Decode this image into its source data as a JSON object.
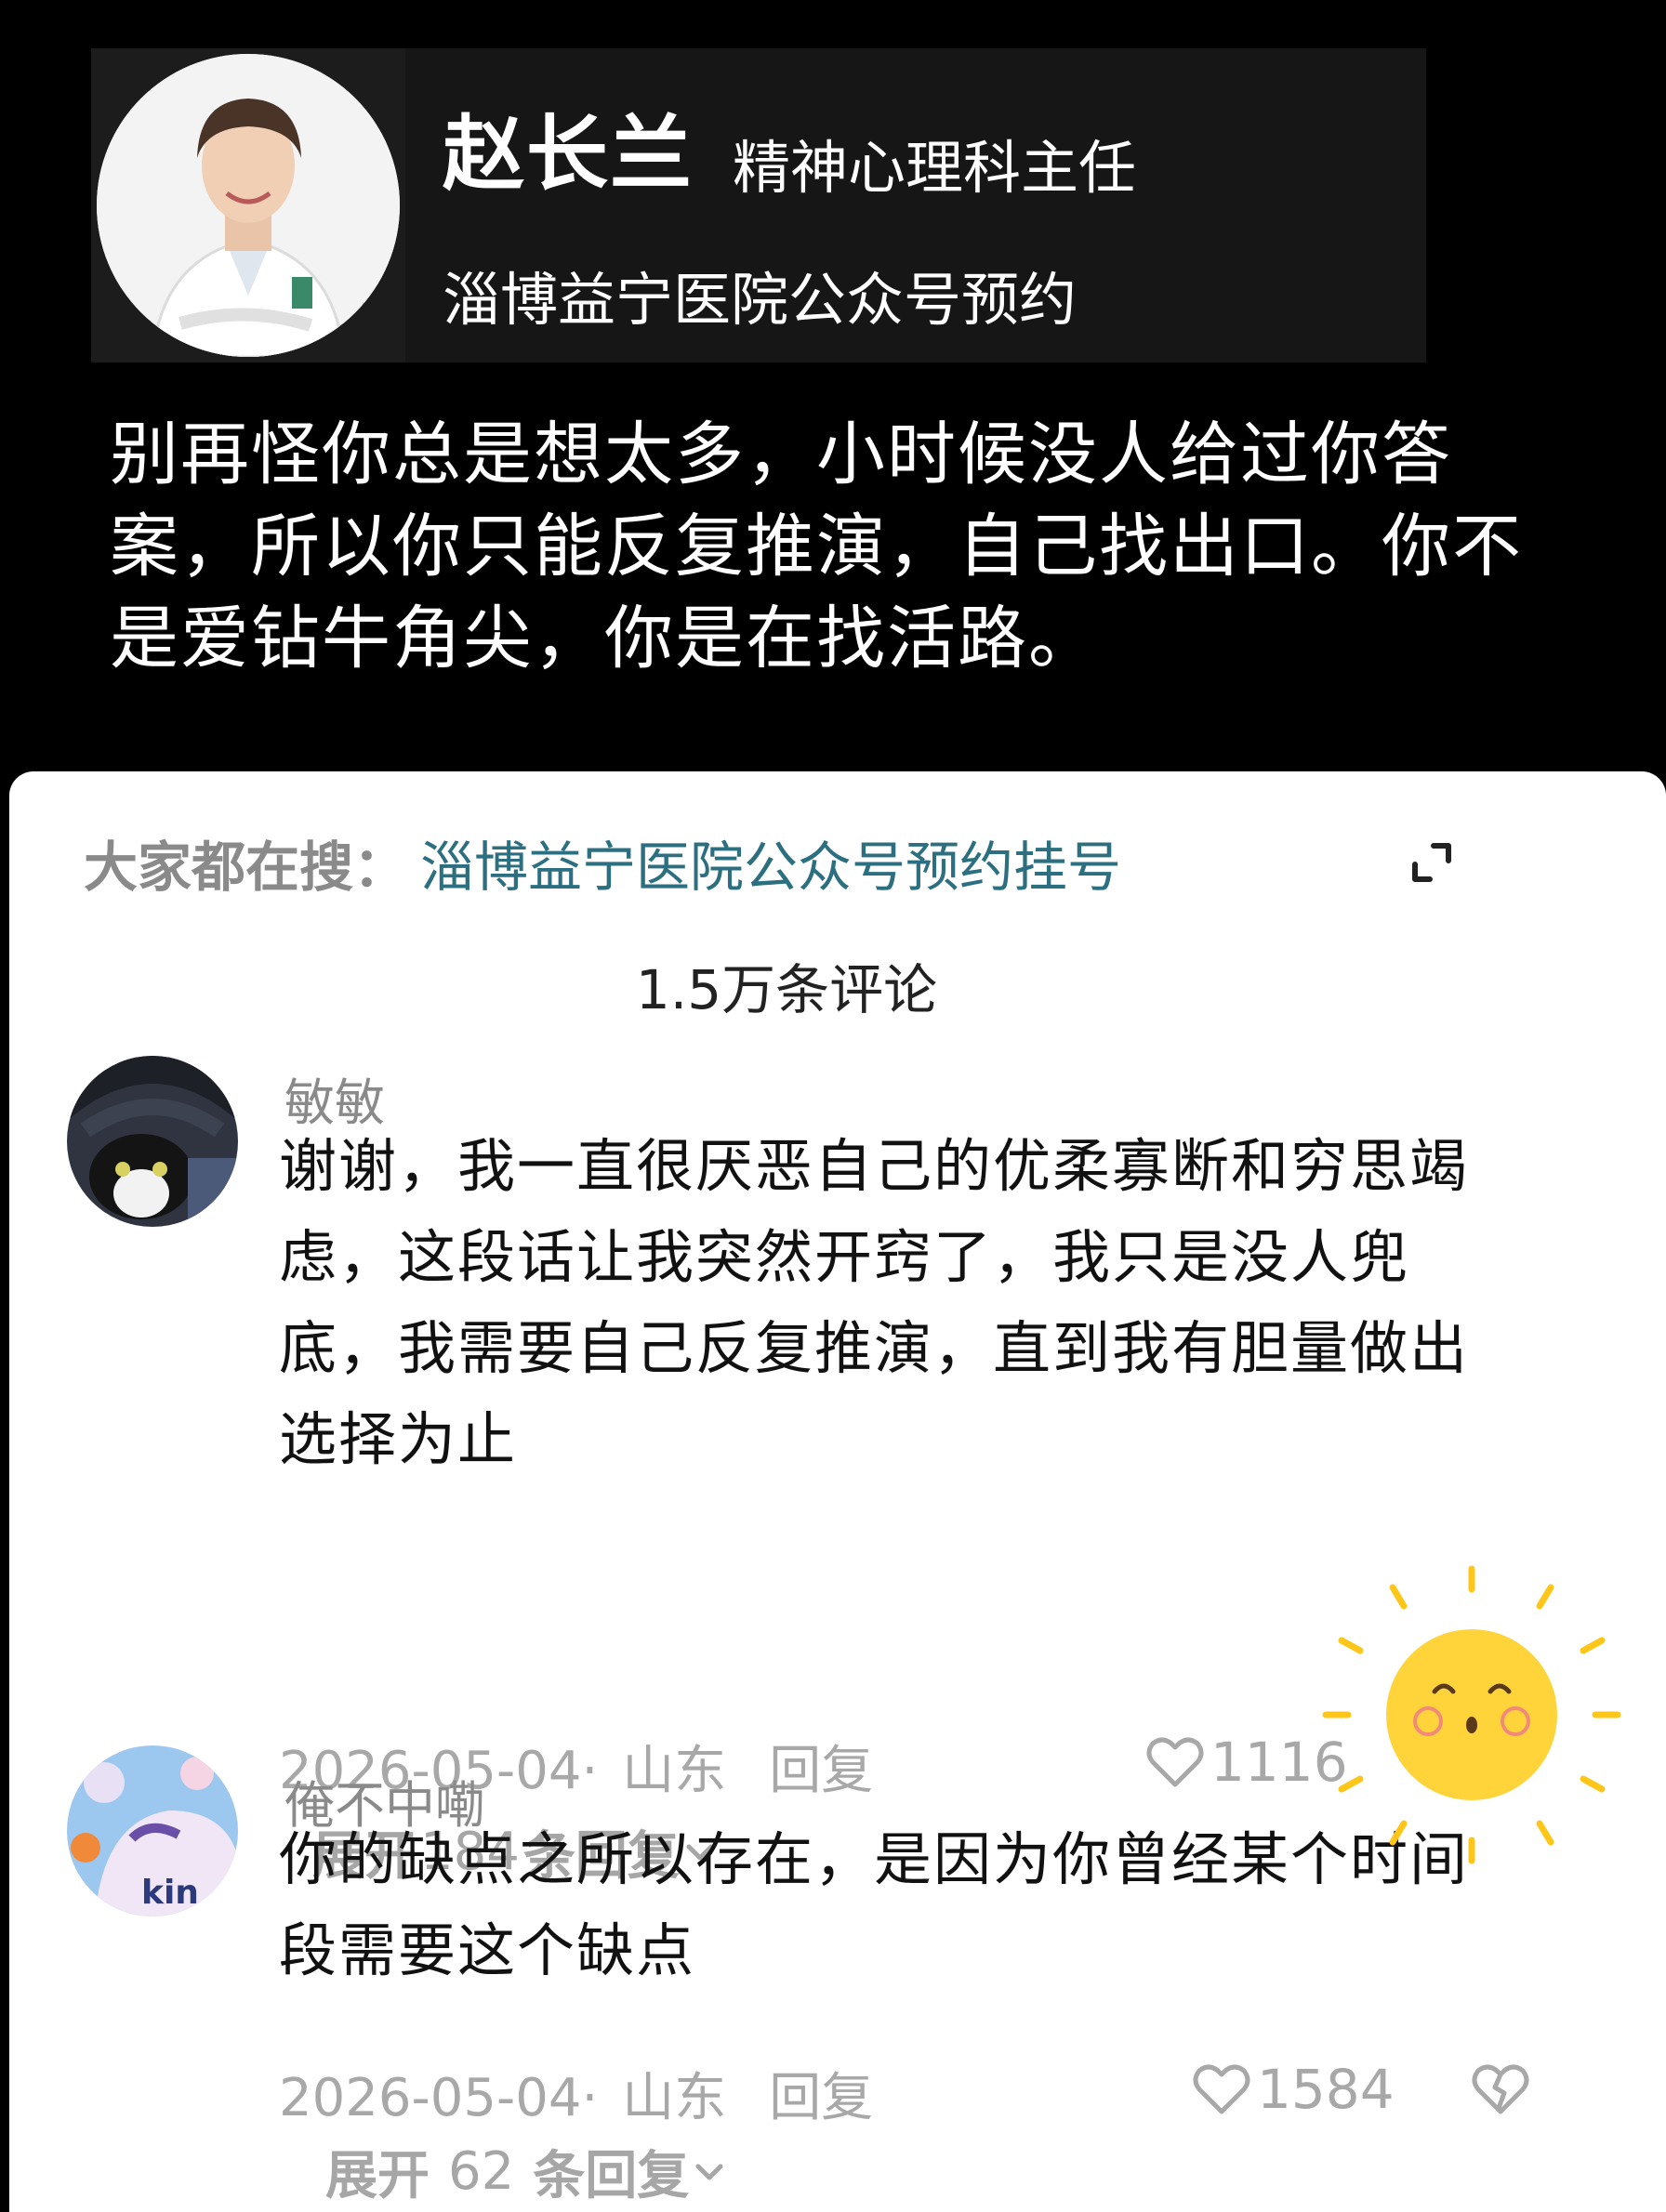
{
  "header": {
    "doctor_name": "赵长兰",
    "doctor_title": "精神心理科主任",
    "subtitle": "淄博益宁医院公众号预约",
    "quote": "别再怪你总是想太多，小时候没人给过你答案，所以你只能反复推演，自己找出口。你不是爱钻牛角尖，你是在找活路。"
  },
  "search": {
    "prefix": "大家都在搜：",
    "term": "淄博益宁医院公众号预约挂号"
  },
  "comment_count": "1.5万条评论",
  "comments": [
    {
      "user": "敏敏",
      "text": "谢谢，我一直很厌恶自己的优柔寡断和穷思竭虑，这段话让我突然开窍了，我只是没人兜底，我需要自己反复推演，直到我有胆量做出选择为止",
      "date": "2026-05-04·",
      "location": "山东",
      "reply": "回复",
      "likes": "1116",
      "expand_prefix": "展开",
      "expand_count": "184",
      "expand_suffix": "条回复"
    },
    {
      "user": "俺不中嘞",
      "text": "你的缺点之所以存在，是因为你曾经某个时间段需要这个缺点",
      "date": "2026-05-04·",
      "location": "山东",
      "reply": "回复",
      "likes": "1584",
      "expand_prefix": "展开",
      "expand_count": "62",
      "expand_suffix": "条回复"
    }
  ],
  "icons": {
    "expand": "expand-icon",
    "like": "heart-icon",
    "dislike": "broken-heart-icon",
    "chevron": "chevron-down-icon",
    "sticker": "sun-sticker"
  },
  "colors": {
    "search_term": "#2b6f80",
    "meta_gray": "#a8a8a8",
    "sun_yellow": "#ffd43b"
  }
}
